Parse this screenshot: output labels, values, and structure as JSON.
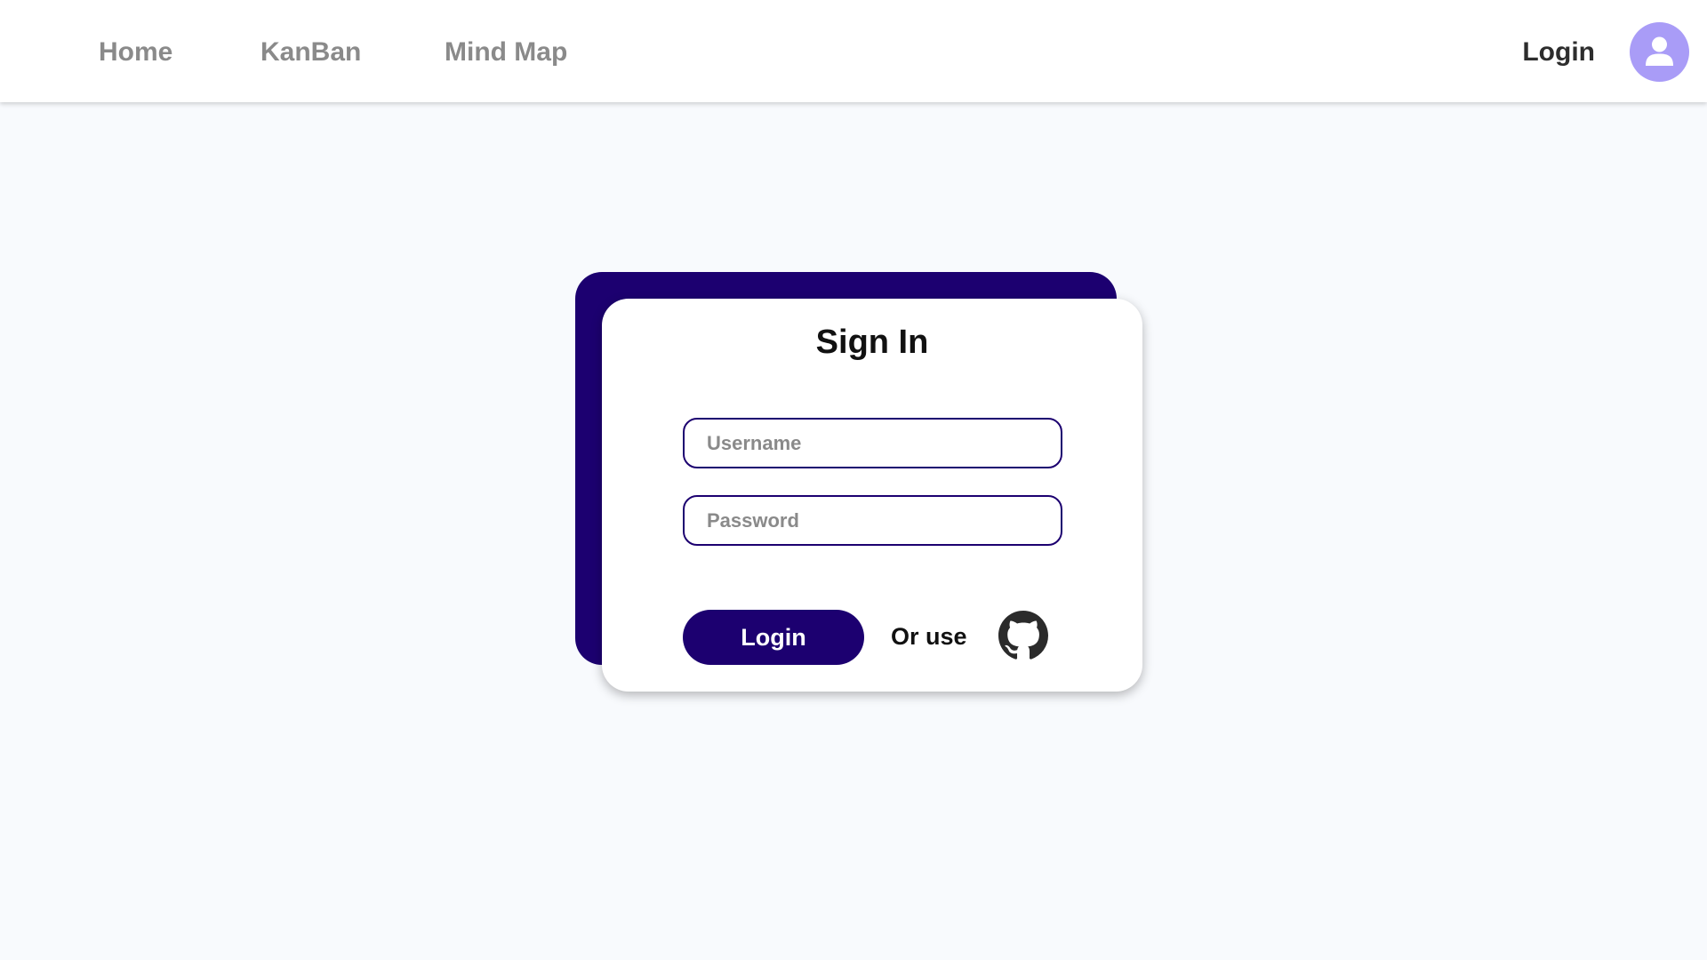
{
  "nav": {
    "items": [
      {
        "label": "Home"
      },
      {
        "label": "KanBan"
      },
      {
        "label": "Mind Map"
      }
    ],
    "login_label": "Login",
    "avatar_icon": "user-icon"
  },
  "signin": {
    "title": "Sign In",
    "username_placeholder": "Username",
    "password_placeholder": "Password",
    "username_value": "",
    "password_value": "",
    "login_button": "Login",
    "alt_text": "Or use",
    "alt_provider_icon": "github-icon"
  },
  "colors": {
    "primary": "#1c0070",
    "avatar_bg": "#a99cf7",
    "page_bg": "#f8fafd",
    "nav_text": "#8a8a8a"
  }
}
